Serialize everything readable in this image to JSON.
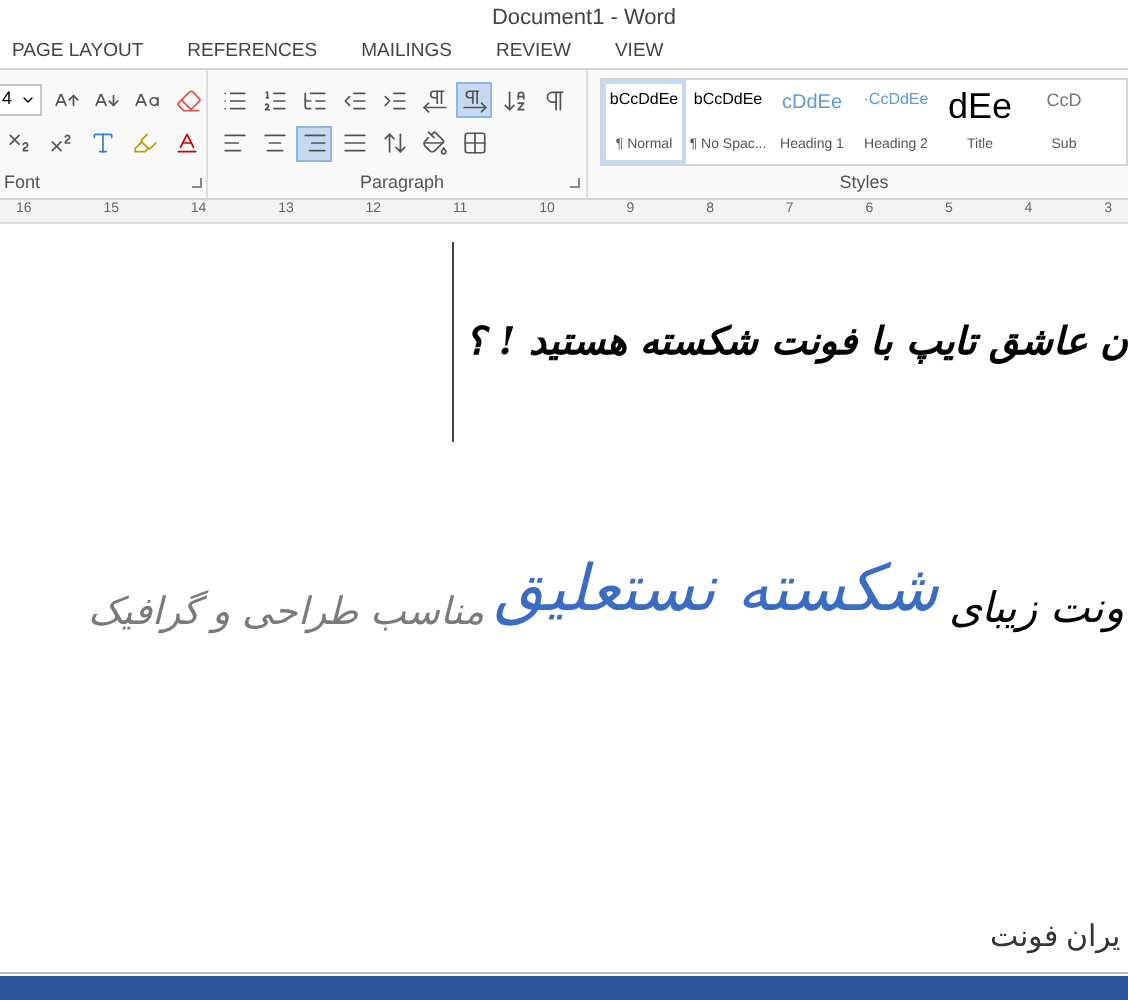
{
  "window": {
    "title": "Document1 - Word"
  },
  "tabs": [
    {
      "label": "PAGE LAYOUT",
      "selected": false
    },
    {
      "label": "REFERENCES",
      "selected": false
    },
    {
      "label": "MAILINGS",
      "selected": false
    },
    {
      "label": "REVIEW",
      "selected": false
    },
    {
      "label": "VIEW",
      "selected": false
    }
  ],
  "font_group": {
    "label": "Font",
    "font_size": "4"
  },
  "paragraph_group": {
    "label": "Paragraph",
    "rtl_selected": true,
    "align_right_selected": true
  },
  "styles_group": {
    "label": "Styles",
    "items": [
      {
        "preview": "bCcDdEe",
        "name": "¶ Normal",
        "kind": "normal",
        "selected": true
      },
      {
        "preview": "bCcDdEe",
        "name": "¶ No Spac...",
        "kind": "normal",
        "selected": false
      },
      {
        "preview": "cDdEe",
        "name": "Heading 1",
        "kind": "heading1",
        "selected": false
      },
      {
        "preview": "·CcDdEe",
        "name": "Heading 2",
        "kind": "heading2",
        "selected": false
      },
      {
        "preview": "dEe",
        "name": "Title",
        "kind": "title",
        "selected": false
      },
      {
        "preview": "CcD",
        "name": "Sub",
        "kind": "subtitle",
        "selected": false
      }
    ]
  },
  "ruler": [
    "16",
    "15",
    "14",
    "13",
    "12",
    "11",
    "10",
    "9",
    "8",
    "7",
    "6",
    "5",
    "4",
    "3"
  ],
  "document": {
    "heading": "ن عاشق تایپ با فونت شکسته هستید ! ؟",
    "banner": [
      {
        "text": "ونت زیبای",
        "kind": "dark"
      },
      {
        "text": "شکسته نستعلیق",
        "kind": "accent"
      },
      {
        "text": "مناسب طراحی و گرافیک",
        "kind": "muted"
      }
    ],
    "footer": "یران فونت"
  }
}
